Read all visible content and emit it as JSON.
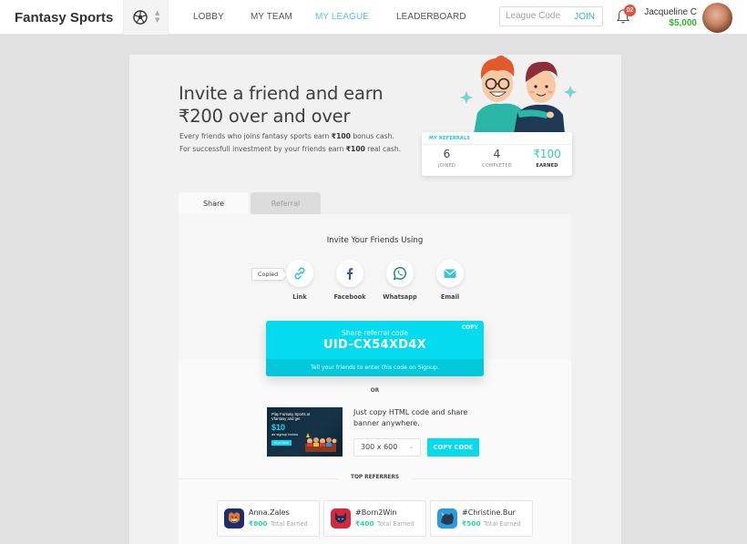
{
  "header": {
    "brand": "Fantasy Sports",
    "sport_icon": "soccer-ball-icon",
    "nav": [
      {
        "label": "LOBBY",
        "active": false
      },
      {
        "label": "MY TEAM",
        "active": false
      },
      {
        "label": "MY LEAGUE",
        "active": true
      },
      {
        "label": "LEADERBOARD",
        "active": false
      }
    ],
    "league_code_placeholder": "League Code",
    "join_label": "JOIN",
    "notification_count": "02",
    "user_name": "Jacqueline C",
    "user_balance": "$5,000"
  },
  "hero": {
    "title_line1": "Invite a friend and earn",
    "title_line2": "₹200 over and over",
    "desc_line1_pre": "Every friends who joins fantasy sports earn ",
    "desc_line1_bold": "₹100",
    "desc_line1_post": " bonus cash.",
    "desc_line2_pre": "For successfull investment by your friends earn ",
    "desc_line2_bold": "₹100",
    "desc_line2_post": " real cash."
  },
  "my_referrals": {
    "label": "MY REFERRALS",
    "stats": [
      {
        "value": "6",
        "caption": "JOINED"
      },
      {
        "value": "4",
        "caption": "COMPLETED"
      },
      {
        "value": "₹100",
        "caption": "EARNED"
      }
    ]
  },
  "tabs": [
    {
      "label": "Share",
      "active": true
    },
    {
      "label": "Referral",
      "active": false
    }
  ],
  "share": {
    "title": "Invite Your Friends Using",
    "copied_tooltip": "Copied",
    "options": [
      {
        "label": "Link",
        "icon": "link-icon"
      },
      {
        "label": "Facebook",
        "icon": "facebook-icon"
      },
      {
        "label": "Whatsapp",
        "icon": "whatsapp-icon"
      },
      {
        "label": "Email",
        "icon": "email-icon"
      }
    ],
    "code_card": {
      "label": "Share referral code",
      "code": "UID-CX54XD4X",
      "copy_label": "COPY",
      "hint": "Tell your friends to enter this code on Signup."
    },
    "or_label": "OR",
    "banner": {
      "line1": "Play Fantasy Sports at",
      "line2": "Vfantasy and get",
      "amount": "$10",
      "line3": "as signup bonus",
      "button": "PLAY NOW"
    },
    "banner_text": "Just copy HTML code and share banner anywhere.",
    "size_selected": "300 x 600",
    "copy_code_label": "COPY CODE"
  },
  "top_referrers": {
    "title": "TOP REFERRERS",
    "items": [
      {
        "name": "Anna.Zales",
        "amount": "₹800",
        "caption": "Total Earned",
        "color": "#1e2d6b"
      },
      {
        "name": "#Born2Win",
        "amount": "₹400",
        "caption": "Total Earned",
        "color": "#d5283c"
      },
      {
        "name": "#Christine.Bur",
        "amount": "₹500",
        "caption": "Total Earned",
        "color": "#2a9bdc"
      }
    ]
  },
  "colors": {
    "accent_cyan": "#04dbef",
    "nav_active": "#5bc0e6",
    "earned_green": "#2ed39a",
    "balance_green": "#2bb52b",
    "badge_red": "#e74c3c"
  }
}
